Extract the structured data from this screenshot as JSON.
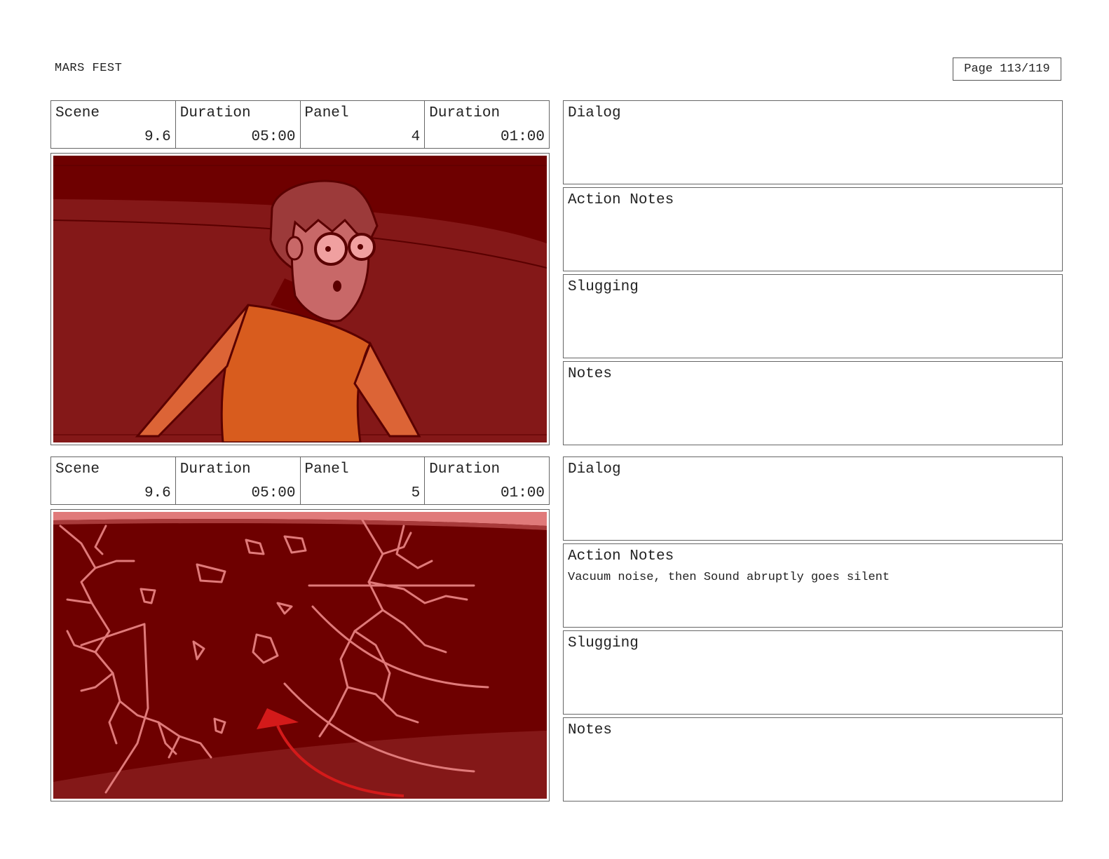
{
  "header": {
    "project_title": "MARS FEST",
    "page_label": "Page 113/119"
  },
  "panels": [
    {
      "scene_label": "Scene",
      "scene_value": "9.6",
      "scene_duration_label": "Duration",
      "scene_duration_value": "05:00",
      "panel_label": "Panel",
      "panel_value": "4",
      "panel_duration_label": "Duration",
      "panel_duration_value": "01:00",
      "image": "frightened-character-sketch",
      "dialog_label": "Dialog",
      "dialog_text": "",
      "action_label": "Action Notes",
      "action_text": "",
      "slugging_label": "Slugging",
      "slugging_text": "",
      "notes_label": "Notes",
      "notes_text": ""
    },
    {
      "scene_label": "Scene",
      "scene_value": "9.6",
      "scene_duration_label": "Duration",
      "scene_duration_value": "05:00",
      "panel_label": "Panel",
      "panel_value": "5",
      "panel_duration_label": "Duration",
      "panel_duration_value": "01:00",
      "image": "cracking-wall-sketch",
      "dialog_label": "Dialog",
      "dialog_text": "",
      "action_label": "Action Notes",
      "action_text": "Vacuum noise, then Sound abruptly goes silent",
      "slugging_label": "Slugging",
      "slugging_text": "",
      "notes_label": "Notes",
      "notes_text": ""
    }
  ],
  "colors": {
    "sketch_dark_red": "#6e0000",
    "sketch_red": "#841818",
    "sketch_line_pink": "#e07a7a",
    "shirt_orange": "#d85c1e",
    "arrow_red": "#d41a1a"
  }
}
